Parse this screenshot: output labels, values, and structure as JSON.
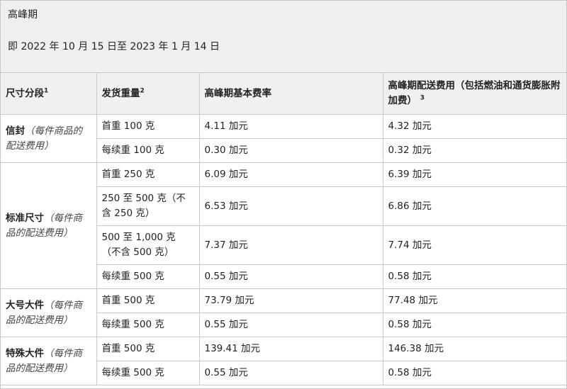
{
  "banner": {
    "title": "高峰期",
    "date_range": "即 2022 年 10 月 15 日至 2023 年 1 月 14 日"
  },
  "table": {
    "headers": {
      "size_tier": "尺寸分段",
      "size_tier_sup": "1",
      "weight": "发货重量",
      "weight_sup": "2",
      "base_rate": "高峰期基本费率",
      "fee": "高峰期配送费用（包括燃油和通货膨胀附加费）",
      "fee_sup": "3"
    },
    "segments": [
      {
        "name": "信封",
        "note": "（每件商品的配送费用）",
        "rows": [
          {
            "weight": "首重 100 克",
            "base": "4.11 加元",
            "fee": "4.32 加元"
          },
          {
            "weight": "每续重 100 克",
            "base": "0.30 加元",
            "fee": "0.32 加元"
          }
        ]
      },
      {
        "name": "标准尺寸",
        "note": "（每件商品的配送费用）",
        "rows": [
          {
            "weight": "首重 250 克",
            "base": "6.09 加元",
            "fee": "6.39 加元"
          },
          {
            "weight": "250 至 500 克（不含 250 克）",
            "base": "6.53 加元",
            "fee": "6.86 加元"
          },
          {
            "weight": "500 至 1,000 克（不含 500 克）",
            "base": "7.37 加元",
            "fee": "7.74 加元"
          },
          {
            "weight": "每续重 500 克",
            "base": "0.55 加元",
            "fee": "0.58 加元"
          }
        ]
      },
      {
        "name": "大号大件",
        "note": "（每件商品的配送费用）",
        "rows": [
          {
            "weight": "首重 500 克",
            "base": "73.79 加元",
            "fee": "77.48 加元"
          },
          {
            "weight": "每续重 500 克",
            "base": "0.55 加元",
            "fee": "0.58 加元"
          }
        ]
      },
      {
        "name": "特殊大件",
        "note": "（每件商品的配送费用）",
        "rows": [
          {
            "weight": "首重 500 克",
            "base": "139.41 加元",
            "fee": "146.38 加元"
          },
          {
            "weight": "每续重 500 克",
            "base": "0.55 加元",
            "fee": "0.58 加元"
          }
        ]
      }
    ]
  }
}
